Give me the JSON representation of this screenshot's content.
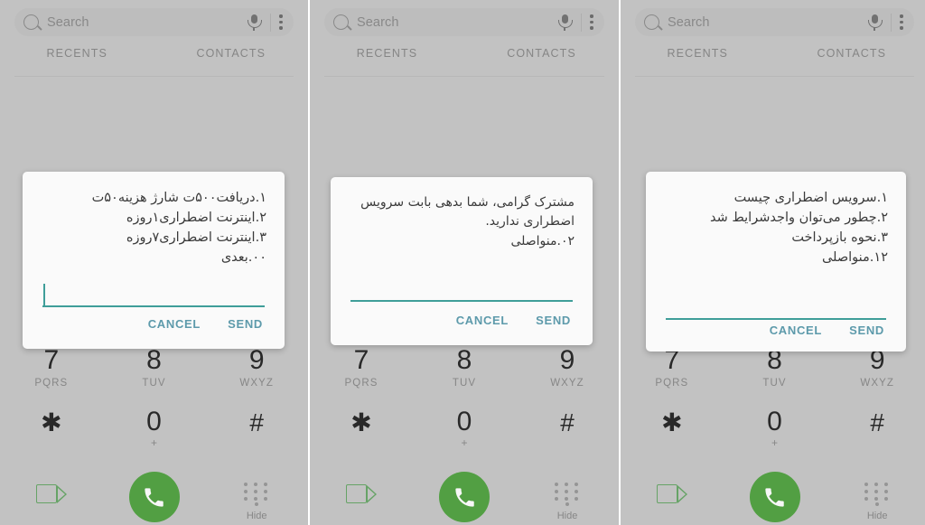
{
  "app": {
    "search": {
      "placeholder": "Search",
      "search_icon": "search-icon",
      "mic_icon": "microphone-icon",
      "overflow_icon": "kebab-menu-icon"
    },
    "tabs": [
      {
        "label": "RECENTS"
      },
      {
        "label": "CONTACTS"
      }
    ],
    "dialpad": {
      "keys": [
        {
          "digit": "7",
          "letters": "PQRS"
        },
        {
          "digit": "8",
          "letters": "TUV"
        },
        {
          "digit": "9",
          "letters": "WXYZ"
        },
        {
          "digit": "✱",
          "letters": ""
        },
        {
          "digit": "0",
          "letters": "+"
        },
        {
          "digit": "#",
          "letters": ""
        }
      ],
      "video_call_icon": "video-camera-icon",
      "call_icon": "phone-handset-icon",
      "hide_icon": "keypad-dots-icon",
      "hide_label": "Hide"
    }
  },
  "colors": {
    "call_green": "#55a546",
    "accent_teal": "#3f9e99",
    "button_blue": "#5d9aab",
    "panel_bg": "#c9c9c9",
    "dialog_bg": "#fafafa"
  },
  "panels": [
    {
      "id": "panel-1",
      "dialog": {
        "message": "۱.دریافت۵۰۰ت شارژ هزینه۵۰ت\n۲.اینترنت اضطراری۱روزه\n۳.اینترنت اضطراری۷روزه\n۰۰.بعدی",
        "input_value": "",
        "cancel_label": "CANCEL",
        "send_label": "SEND",
        "caret_visible": true
      }
    },
    {
      "id": "panel-2",
      "dialog": {
        "message": "مشترک گرامی، شما بدهی بابت سرویس اضطراری ندارید.\n۰۲.منواصلی",
        "input_value": "",
        "cancel_label": "CANCEL",
        "send_label": "SEND",
        "caret_visible": false
      }
    },
    {
      "id": "panel-3",
      "dialog": {
        "message": "۱.سرویس اضطراری چیست\n۲.چطور می‌توان واجدشرایط شد\n۳.نحوه بازپرداخت\n۱۲.منواصلی",
        "input_value": "",
        "cancel_label": "CANCEL",
        "send_label": "SEND",
        "caret_visible": false
      }
    }
  ]
}
